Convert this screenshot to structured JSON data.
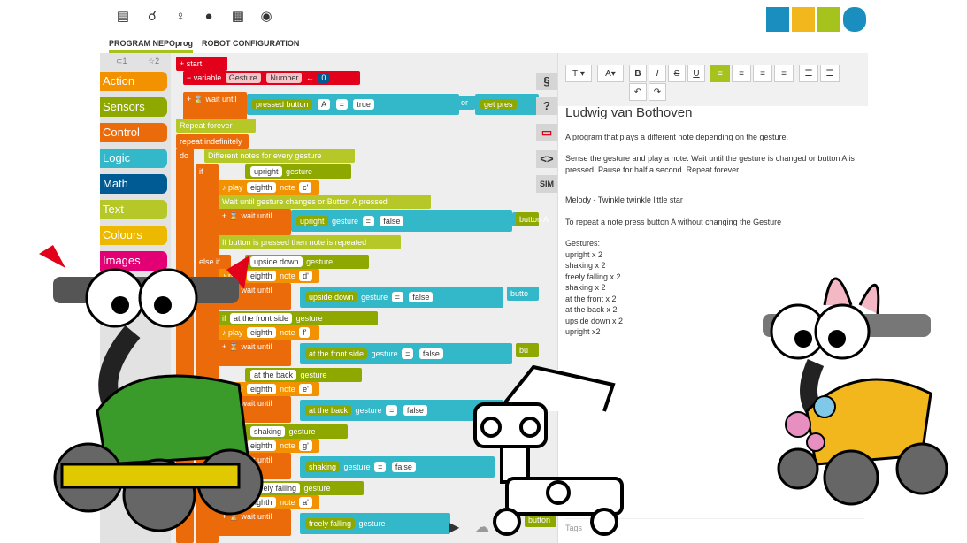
{
  "nav": {
    "icons": [
      "document-icon",
      "robot-program-icon",
      "lightbulb-icon",
      "user-icon",
      "gallery-icon",
      "globe-icon"
    ]
  },
  "logo": {
    "colors": [
      "#1a8ebf",
      "#f1b71c",
      "#a5c21d",
      "#1a8ebf"
    ]
  },
  "tabs": {
    "program": "PROGRAM NEPOprog",
    "config": "ROBOT CONFIGURATION"
  },
  "toolbox": {
    "tab1": "⊂1",
    "tab2": "☆2",
    "categories": [
      {
        "label": "Action",
        "color": "#f39200"
      },
      {
        "label": "Sensors",
        "color": "#8fa800"
      },
      {
        "label": "Control",
        "color": "#eb6a0a"
      },
      {
        "label": "Logic",
        "color": "#33b8ca"
      },
      {
        "label": "Math",
        "color": "#005a94"
      },
      {
        "label": "Text",
        "color": "#b5c828"
      },
      {
        "label": "Colours",
        "color": "#ecb800"
      },
      {
        "label": "Images",
        "color": "#e20074"
      }
    ]
  },
  "blocks": {
    "start": "+  start",
    "variable": "−  variable",
    "var_name": "Gesture",
    "var_type": "Number",
    "var_value": "0",
    "wait_until": "wait until",
    "get_pressed": "get",
    "pressed_button": "pressed  button",
    "button_a": "A",
    "eq": "=",
    "true_val": "true",
    "or": "or",
    "get_pres": "get   pres",
    "repeat_comment": "Repeat forever",
    "repeat_indef": "repeat indefinitely",
    "do": "do",
    "comment_notes": "Different notes for every gesture",
    "if": "if",
    "else_if": "else if",
    "get": "get",
    "gesture": "gesture",
    "upright": "upright",
    "play": "play",
    "eighth": "eighth",
    "note": "note",
    "note_c": "c'",
    "note_d": "d'",
    "note_f": "f'",
    "note_e": "e'",
    "note_g": "g'",
    "note_a": "a'",
    "comment_wait": "Wait until gesture changes or Button A pressed",
    "false_val": "false",
    "button_A": "button  A",
    "comment_button": "If button is pressed then note is repeated",
    "upside_down": "upside down",
    "front_side": "at the front side",
    "back": "at the back",
    "shaking": "shaking",
    "freely_falling": "freely falling",
    "butto": "butto",
    "button_cut": "button",
    "bu": "bu"
  },
  "side_buttons": [
    "§",
    "?",
    "▭",
    "<>",
    "SIM"
  ],
  "editor": {
    "font_size": "T!▾",
    "font_color": "A▾",
    "bold": "B",
    "italic": "I",
    "strike": "S",
    "underline": "U",
    "undo": "↶",
    "redo": "↷"
  },
  "description": {
    "title": "Ludwig van Bothoven",
    "p1": "A program that plays a different note depending on the gesture.",
    "p2": "Sense the gesture and play a note. Wait until the gesture is changed or button A is pressed. Pause for half a second. Repeat forever.",
    "p3": "Melody - Twinkle twinkle little star",
    "p4": "To repeat a note press button A without changing the Gesture",
    "gestures_title": "Gestures:",
    "gestures": [
      "upright x 2",
      "shaking x 2",
      "freely falling x 2",
      "shaking x 2",
      "at the front x 2",
      "at the back x 2",
      "upside down x 2",
      "upright x2"
    ]
  },
  "tags_placeholder": "Tags",
  "bottom_controls": [
    "play-icon",
    "cloud-icon",
    "zoom-icon"
  ]
}
